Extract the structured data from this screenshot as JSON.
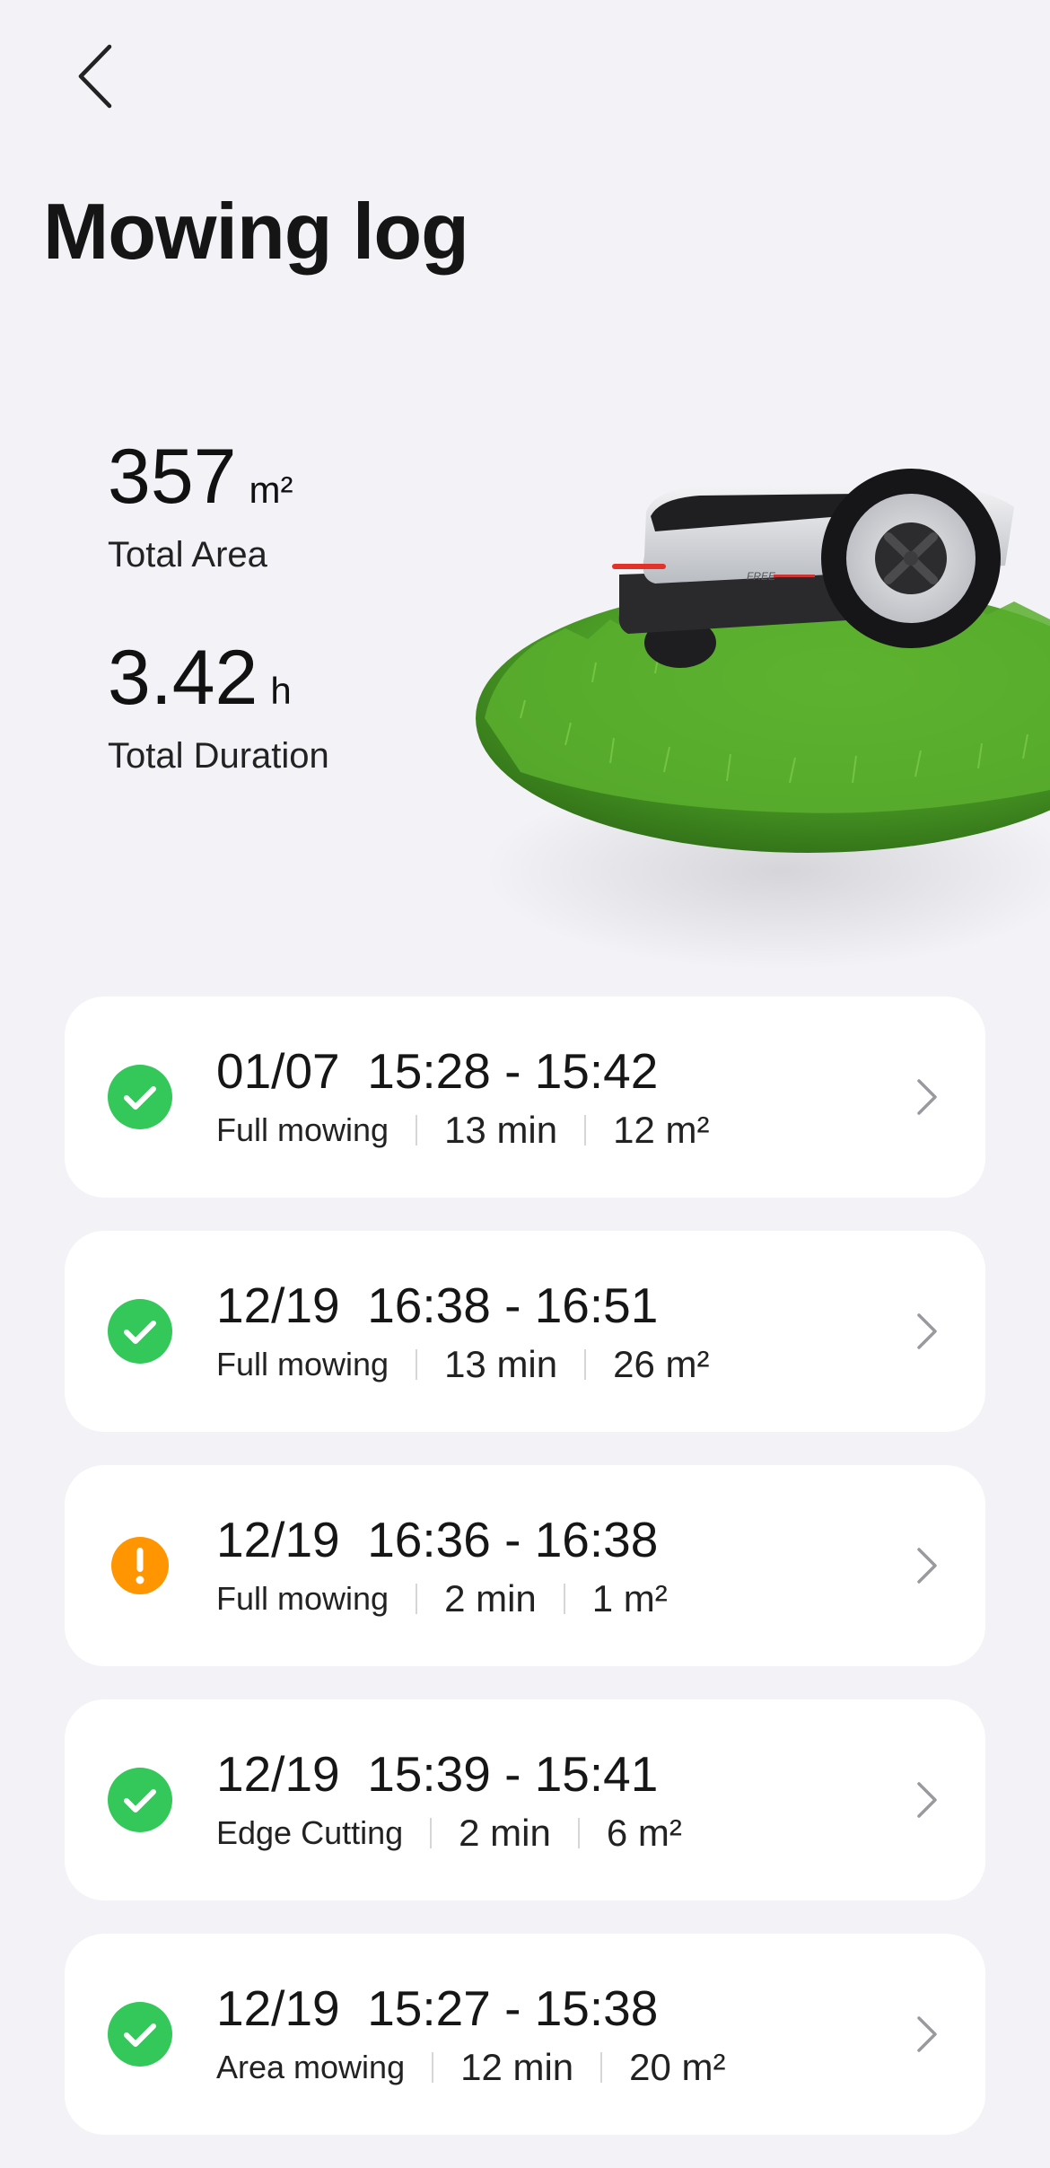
{
  "header": {
    "title": "Mowing log"
  },
  "stats": {
    "total_area": {
      "value": "357",
      "unit": "m²",
      "label": "Total Area"
    },
    "total_duration": {
      "value": "3.42",
      "unit": "h",
      "label": "Total Duration"
    }
  },
  "hero": {
    "mower_badge_text": "FREE"
  },
  "colors": {
    "background": "#f2f2f7",
    "card": "#ffffff",
    "success": "#34c759",
    "warning": "#ff9500",
    "grass": "#4fa52a"
  },
  "icons": {
    "back": "chevron-left-icon",
    "success": "checkmark-circle-icon",
    "warning": "exclamation-circle-icon",
    "row": "chevron-right-icon"
  },
  "sessions": [
    {
      "date": "01/07",
      "time_range": "15:28 - 15:42",
      "mode": "Full mowing",
      "duration": "13 min",
      "area": "12 m²",
      "status": "success"
    },
    {
      "date": "12/19",
      "time_range": "16:38 - 16:51",
      "mode": "Full mowing",
      "duration": "13 min",
      "area": "26 m²",
      "status": "success"
    },
    {
      "date": "12/19",
      "time_range": "16:36 - 16:38",
      "mode": "Full mowing",
      "duration": "2 min",
      "area": "1 m²",
      "status": "warning"
    },
    {
      "date": "12/19",
      "time_range": "15:39 - 15:41",
      "mode": "Edge Cutting",
      "duration": "2 min",
      "area": "6 m²",
      "status": "success"
    },
    {
      "date": "12/19",
      "time_range": "15:27 - 15:38",
      "mode": "Area mowing",
      "duration": "12 min",
      "area": "20 m²",
      "status": "success"
    }
  ]
}
